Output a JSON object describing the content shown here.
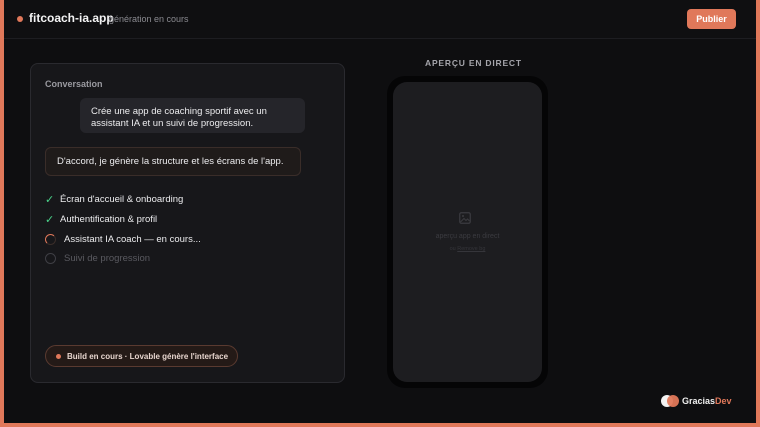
{
  "header": {
    "app_name": "fitcoach-ia.app",
    "status": "génération en cours",
    "publish_label": "Publier"
  },
  "chat": {
    "title": "Conversation",
    "user_message": "Crée une app de coaching sportif avec un assistant IA et un suivi de progression.",
    "ai_message": "D'accord, je génère la structure et les écrans de l'app.",
    "tasks": [
      {
        "label": "Écran d'accueil & onboarding",
        "state": "done"
      },
      {
        "label": "Authentification & profil",
        "state": "done"
      },
      {
        "label": "Assistant IA coach — en cours...",
        "state": "loading"
      },
      {
        "label": "Suivi de progression",
        "state": "pending"
      }
    ],
    "build_status": "Build en cours · Lovable génère l'interface"
  },
  "preview": {
    "title": "APERÇU EN DIRECT",
    "placeholder_label": "aperçu app en direct",
    "placeholder_sub_prefix": "ou",
    "placeholder_sub_link": "Remove bg"
  },
  "brand": {
    "name_main": "Gracias",
    "name_accent": "Dev"
  },
  "colors": {
    "accent": "#e0785a",
    "success": "#4ad28a",
    "background": "#0e0e10"
  }
}
